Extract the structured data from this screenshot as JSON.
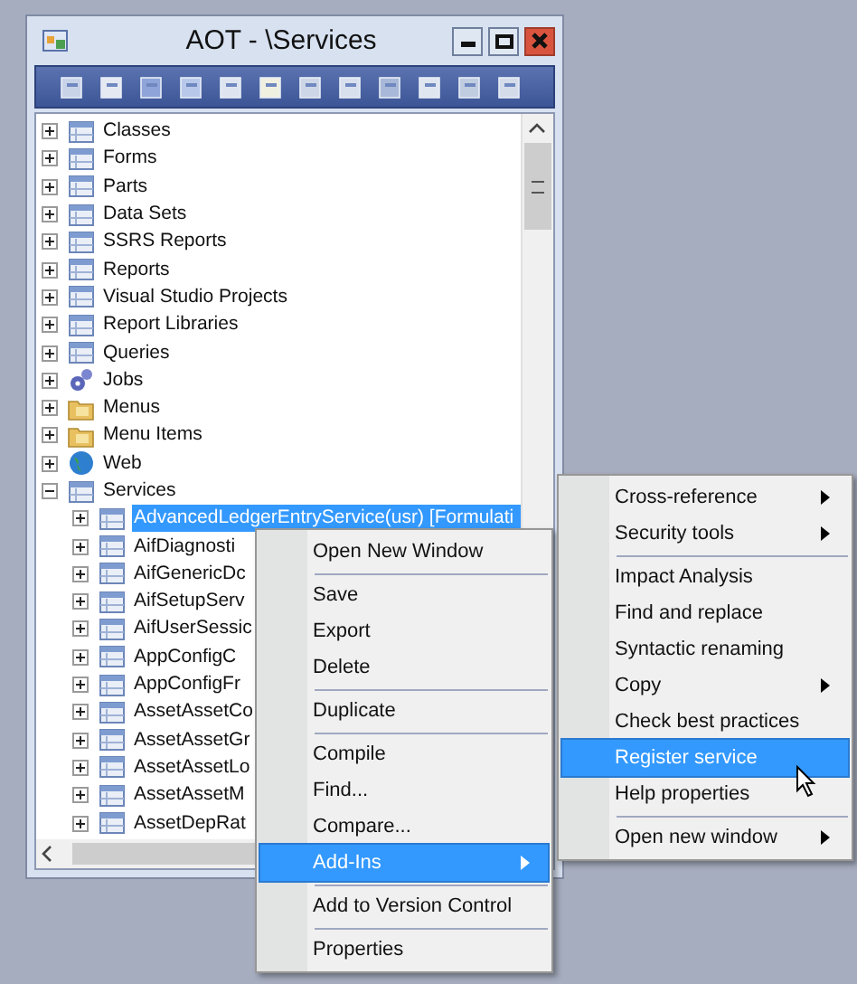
{
  "window": {
    "title": "AOT - \\Services"
  },
  "tree": [
    {
      "label": "Classes",
      "kind": "grid",
      "expanded": false,
      "selected": false
    },
    {
      "label": "Forms",
      "kind": "grid",
      "expanded": false,
      "selected": false
    },
    {
      "label": "Parts",
      "kind": "grid",
      "expanded": false,
      "selected": false
    },
    {
      "label": "Data Sets",
      "kind": "grid",
      "expanded": false,
      "selected": false
    },
    {
      "label": "SSRS Reports",
      "kind": "grid",
      "expanded": false,
      "selected": false
    },
    {
      "label": "Reports",
      "kind": "grid",
      "expanded": false,
      "selected": false
    },
    {
      "label": "Visual Studio Projects",
      "kind": "grid",
      "expanded": false,
      "selected": false
    },
    {
      "label": "Report Libraries",
      "kind": "grid",
      "expanded": false,
      "selected": false
    },
    {
      "label": "Queries",
      "kind": "grid",
      "expanded": false,
      "selected": false
    },
    {
      "label": "Jobs",
      "kind": "gears",
      "expanded": false,
      "selected": false
    },
    {
      "label": "Menus",
      "kind": "folder",
      "expanded": false,
      "selected": false
    },
    {
      "label": "Menu Items",
      "kind": "folder",
      "expanded": false,
      "selected": false
    },
    {
      "label": "Web",
      "kind": "globe",
      "expanded": false,
      "selected": false
    },
    {
      "label": "Services",
      "kind": "grid",
      "expanded": true,
      "selected": false,
      "children": [
        {
          "label": "AdvancedLedgerEntryService(usr) [Formulati",
          "kind": "grid",
          "expanded": false,
          "selected": true
        },
        {
          "label": "AifDiagnosti",
          "kind": "grid",
          "expanded": false,
          "selected": false
        },
        {
          "label": "AifGenericDc",
          "kind": "grid",
          "expanded": false,
          "selected": false
        },
        {
          "label": "AifSetupServ",
          "kind": "grid",
          "expanded": false,
          "selected": false
        },
        {
          "label": "AifUserSessic",
          "kind": "grid",
          "expanded": false,
          "selected": false
        },
        {
          "label": "AppConfigC",
          "kind": "grid",
          "expanded": false,
          "selected": false
        },
        {
          "label": "AppConfigFr",
          "kind": "grid",
          "expanded": false,
          "selected": false
        },
        {
          "label": "AssetAssetCo",
          "kind": "grid",
          "expanded": false,
          "selected": false
        },
        {
          "label": "AssetAssetGr",
          "kind": "grid",
          "expanded": false,
          "selected": false
        },
        {
          "label": "AssetAssetLo",
          "kind": "grid",
          "expanded": false,
          "selected": false
        },
        {
          "label": "AssetAssetM",
          "kind": "grid",
          "expanded": false,
          "selected": false
        },
        {
          "label": "AssetDepRat",
          "kind": "grid",
          "expanded": false,
          "selected": false
        }
      ]
    }
  ],
  "context_menu": [
    {
      "label": "Open New Window",
      "submenu": false,
      "selected": false,
      "separator_after": true
    },
    {
      "label": "Save",
      "submenu": false,
      "selected": false,
      "separator_after": false
    },
    {
      "label": "Export",
      "submenu": false,
      "selected": false,
      "separator_after": false
    },
    {
      "label": "Delete",
      "submenu": false,
      "selected": false,
      "separator_after": true
    },
    {
      "label": "Duplicate",
      "submenu": false,
      "selected": false,
      "separator_after": true
    },
    {
      "label": "Compile",
      "submenu": false,
      "selected": false,
      "separator_after": false
    },
    {
      "label": "Find...",
      "submenu": false,
      "selected": false,
      "separator_after": false
    },
    {
      "label": "Compare...",
      "submenu": false,
      "selected": false,
      "separator_after": false
    },
    {
      "label": "Add-Ins",
      "submenu": true,
      "selected": true,
      "separator_after": true
    },
    {
      "label": "Add to Version Control",
      "submenu": false,
      "selected": false,
      "separator_after": true
    },
    {
      "label": "Properties",
      "submenu": false,
      "selected": false,
      "separator_after": false
    }
  ],
  "submenu": [
    {
      "label": "Cross-reference",
      "submenu": true,
      "selected": false,
      "separator_after": false
    },
    {
      "label": "Security tools",
      "submenu": true,
      "selected": false,
      "separator_after": true
    },
    {
      "label": "Impact Analysis",
      "submenu": false,
      "selected": false,
      "separator_after": false
    },
    {
      "label": "Find and replace",
      "submenu": false,
      "selected": false,
      "separator_after": false
    },
    {
      "label": "Syntactic renaming",
      "submenu": false,
      "selected": false,
      "separator_after": false
    },
    {
      "label": "Copy",
      "submenu": true,
      "selected": false,
      "separator_after": false
    },
    {
      "label": "Check best practices",
      "submenu": false,
      "selected": false,
      "separator_after": false
    },
    {
      "label": "Register service",
      "submenu": false,
      "selected": true,
      "separator_after": false
    },
    {
      "label": "Help properties",
      "submenu": false,
      "selected": false,
      "separator_after": true
    },
    {
      "label": "Open new window",
      "submenu": true,
      "selected": false,
      "separator_after": false
    }
  ]
}
